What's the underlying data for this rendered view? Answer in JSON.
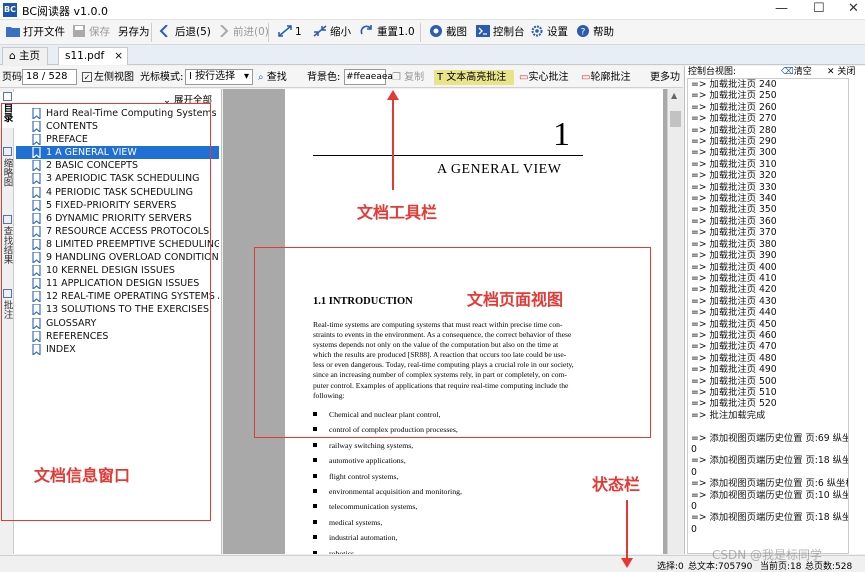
{
  "app": {
    "title": "BC阅读器 v1.0.0",
    "logo": "BC"
  },
  "window_controls": {
    "minimize": "—",
    "maximize": "☐",
    "close": "✕"
  },
  "toolbar": {
    "open": "打开文件",
    "save": "保存",
    "saveas": "另存为",
    "back": "后退(5)",
    "forward": "前进(0)",
    "one": "1",
    "shrink": "缩小",
    "reset": "重置1.0",
    "screenshot": "截图",
    "console": "控制台",
    "settings": "设置",
    "help": "帮助"
  },
  "tabs": [
    {
      "label": "主页"
    },
    {
      "label": "s11.pdf"
    }
  ],
  "doc_toolbar": {
    "page_label": "页码",
    "page_value": "18 / 528",
    "left_view": "左侧视图",
    "cursor_label": "光标模式:",
    "cursor_value": "按行选择",
    "find": "查找",
    "bg_label": "背景色:",
    "bg_value": "#ffeaeaea",
    "copy": "复制",
    "text_highlight": "文本高亮批注",
    "solid_note": "实心批注",
    "outline_note": "轮廓批注",
    "more": "更多功"
  },
  "left_panel": {
    "expand_all": "展开全部",
    "vtabs": [
      "目录",
      "缩略图",
      "查找结果",
      "批注"
    ],
    "toc": [
      "Hard Real-Time Computing Systems",
      "CONTENTS",
      "PREFACE",
      "1 A GENERAL VIEW",
      "2 BASIC CONCEPTS",
      "3 APERIODIC TASK SCHEDULING",
      "4 PERIODIC TASK SCHEDULING",
      "5 FIXED-PRIORITY SERVERS",
      "6 DYNAMIC PRIORITY SERVERS",
      "7 RESOURCE ACCESS PROTOCOLS",
      "8 LIMITED PREEMPTIVE SCHEDULING",
      "9 HANDLING OVERLOAD CONDITIONS",
      "10 KERNEL DESIGN ISSUES",
      "11 APPLICATION DESIGN ISSUES",
      "12 REAL-TIME OPERATING SYSTEMS A...",
      "13 SOLUTIONS TO THE EXERCISES",
      "GLOSSARY",
      "REFERENCES",
      "INDEX"
    ],
    "selected_index": 3
  },
  "page": {
    "chapter_num": "1",
    "chapter_title": "A GENERAL VIEW",
    "section": "1.1     INTRODUCTION",
    "para": [
      "Real-time systems are computing systems that must react within precise time con-",
      "straints to events in the environment. As a consequence, the correct behavior of these",
      "systems depends not only on the value of the computation but also on the time at",
      "which the results are produced [SR88]. A reaction that occurs too late could be use-",
      "less or even dangerous. Today, real-time computing plays a crucial role in our society,",
      "since an increasing number of complex systems rely, in part or completely, on com-",
      "puter control. Examples of applications that require real-time computing include the",
      "following:"
    ],
    "bullets": [
      "Chemical and nuclear plant control,",
      "control of complex production processes,",
      "railway switching systems,",
      "automotive applications,",
      "flight control systems,",
      "environmental acquisition and monitoring,",
      "telecommunication systems,",
      "medical systems,",
      "industrial automation,",
      "robotics,"
    ]
  },
  "console": {
    "title": "控制台视图:",
    "clear": "清空",
    "close": "关闭",
    "lines": [
      "=> 加载批注页 240",
      "=> 加载批注页 250",
      "=> 加载批注页 260",
      "=> 加载批注页 270",
      "=> 加载批注页 280",
      "=> 加载批注页 290",
      "=> 加载批注页 300",
      "=> 加载批注页 310",
      "=> 加载批注页 320",
      "=> 加载批注页 330",
      "=> 加载批注页 340",
      "=> 加载批注页 350",
      "=> 加载批注页 360",
      "=> 加载批注页 370",
      "=> 加载批注页 380",
      "=> 加载批注页 390",
      "=> 加载批注页 400",
      "=> 加载批注页 410",
      "=> 加载批注页 420",
      "=> 加载批注页 430",
      "=> 加载批注页 440",
      "=> 加载批注页 450",
      "=> 加载批注页 460",
      "=> 加载批注页 470",
      "=> 加载批注页 480",
      "=> 加载批注页 490",
      "=> 加载批注页 500",
      "=> 加载批注页 510",
      "=> 加载批注页 520",
      "=> 批注加载完成",
      "",
      "=> 添加视图页端历史位置 页:69  纵坐标:",
      "0",
      "=> 添加视图页端历史位置 页:18  纵坐标:",
      "0",
      "=> 添加视图页端历史位置 页:6  纵坐标:0",
      "=> 添加视图页端历史位置 页:10  纵坐标:",
      "0",
      "=> 添加视图页端历史位置 页:18  纵坐标:",
      "0"
    ]
  },
  "status": {
    "selected": "选择:0",
    "total_text": "总文本:705790",
    "current_page": "当前页:18",
    "total_pages": "总页数:528",
    "watermark": "CSDN @我是标同学"
  },
  "annotations": {
    "doc_toolbar": "文档工具栏",
    "page_view": "文档页面视图",
    "info_window": "文档信息窗口",
    "status_bar": "状态栏"
  }
}
